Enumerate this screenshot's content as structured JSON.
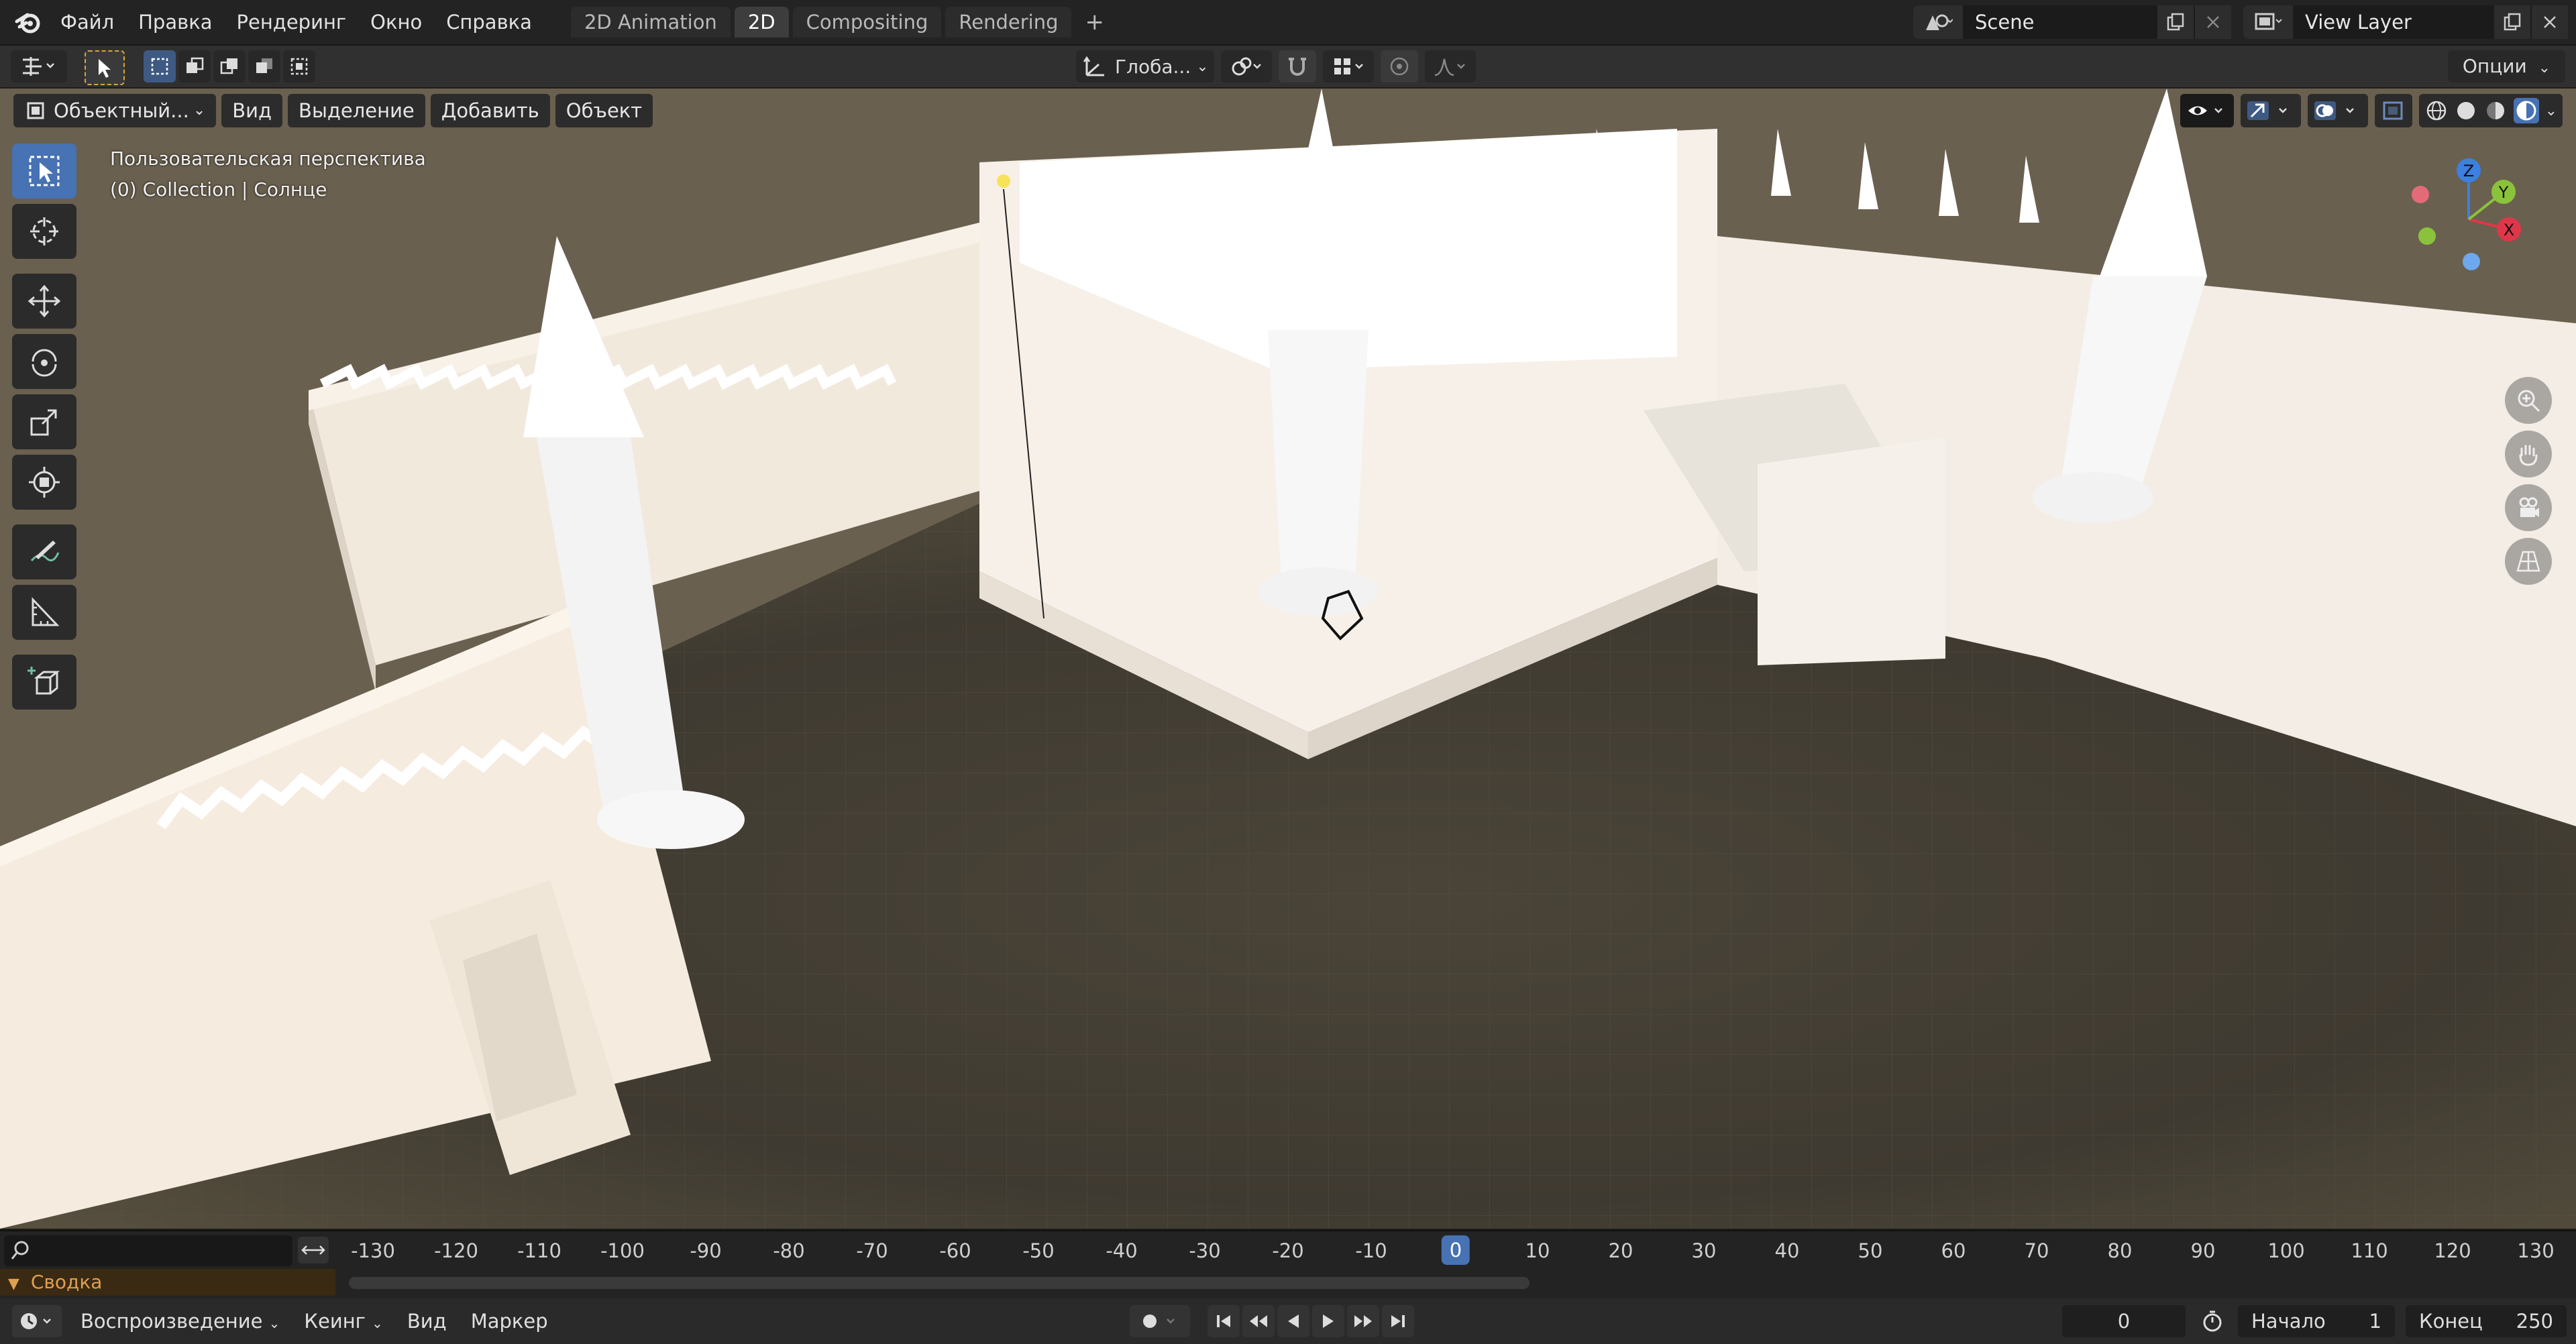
{
  "menu": {
    "items": [
      "Файл",
      "Правка",
      "Рендеринг",
      "Окно",
      "Справка"
    ]
  },
  "workspaces": {
    "tabs": [
      "2D Animation",
      "2D",
      "Compositing",
      "Rendering"
    ],
    "active": "2D"
  },
  "scene": {
    "name": "Scene",
    "view_layer": "View Layer"
  },
  "tool_header": {
    "transform_space": "Глоба...",
    "options": "Опции"
  },
  "viewport": {
    "mode": "Объектный...",
    "menus": [
      "Вид",
      "Выделение",
      "Добавить",
      "Объект"
    ],
    "info_line1": "Пользовательская перспектива",
    "info_line2": "(0) Collection | Солнце",
    "gizmo": {
      "x": "X",
      "y": "Y",
      "z": "Z"
    }
  },
  "timeline": {
    "ticks": [
      "-130",
      "-120",
      "-110",
      "-100",
      "-90",
      "-80",
      "-70",
      "-60",
      "-50",
      "-40",
      "-30",
      "-20",
      "-10",
      "0",
      "10",
      "20",
      "30",
      "40",
      "50",
      "60",
      "70",
      "80",
      "90",
      "100",
      "110",
      "120",
      "130"
    ],
    "current_frame": "0",
    "summary_label": "Сводка"
  },
  "playback": {
    "menus": [
      "Воспроизведение",
      "Кеинг",
      "Вид",
      "Маркер"
    ],
    "frame_value": "0",
    "start_label": "Начало",
    "start_value": "1",
    "end_label": "Конец",
    "end_value": "250"
  },
  "colors": {
    "accent": "#4772b3",
    "header_bg": "#232323",
    "gizmo_x": "#e0364a",
    "gizmo_y": "#8ac33b",
    "gizmo_z": "#3c80e0"
  }
}
